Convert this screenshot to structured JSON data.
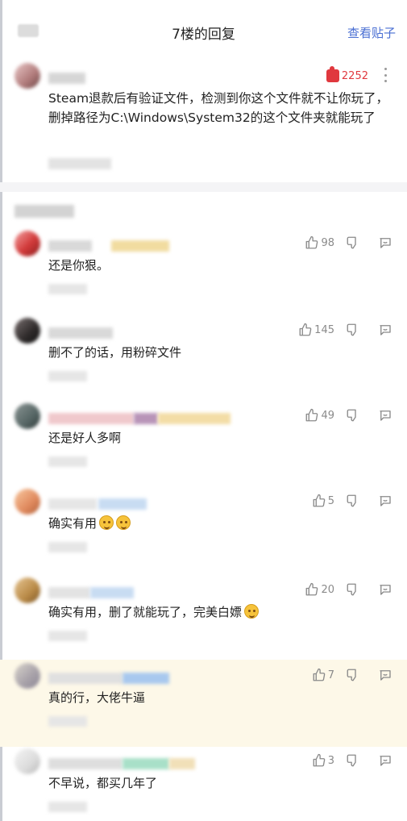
{
  "header": {
    "title": "7楼的回复",
    "view_post_label": "查看贴子"
  },
  "main_reply": {
    "like_count": "2252",
    "text": "Steam退款后有验证文件，检测到你这个文件就不让你玩了，删掉路径为C:\\Windows\\System32的这个文件夹就能玩了"
  },
  "comments": [
    {
      "text": "还是你狠。",
      "likes": "98",
      "emoji_count": 0,
      "highlight": false
    },
    {
      "text": "删不了的话，用粉碎文件",
      "likes": "145",
      "emoji_count": 0,
      "highlight": false
    },
    {
      "text": "还是好人多啊",
      "likes": "49",
      "emoji_count": 0,
      "highlight": false
    },
    {
      "text": "确实有用",
      "likes": "5",
      "emoji_count": 2,
      "highlight": false
    },
    {
      "text": "确实有用，删了就能玩了，完美白嫖",
      "likes": "20",
      "emoji_count": 1,
      "highlight": false
    },
    {
      "text": "真的行，大佬牛逼",
      "likes": "7",
      "emoji_count": 0,
      "highlight": true
    },
    {
      "text": "不早说，都买几年了",
      "likes": "3",
      "emoji_count": 0,
      "highlight": false
    }
  ],
  "icons": {
    "like": "thumbs-up-icon",
    "dislike": "thumbs-down-icon",
    "reply": "reply-bubble-icon",
    "more": "more-vertical-icon"
  },
  "colors": {
    "accent_blue": "#4a6fd3",
    "like_red": "#e0383e",
    "highlight_bg": "#fdf8e8"
  }
}
